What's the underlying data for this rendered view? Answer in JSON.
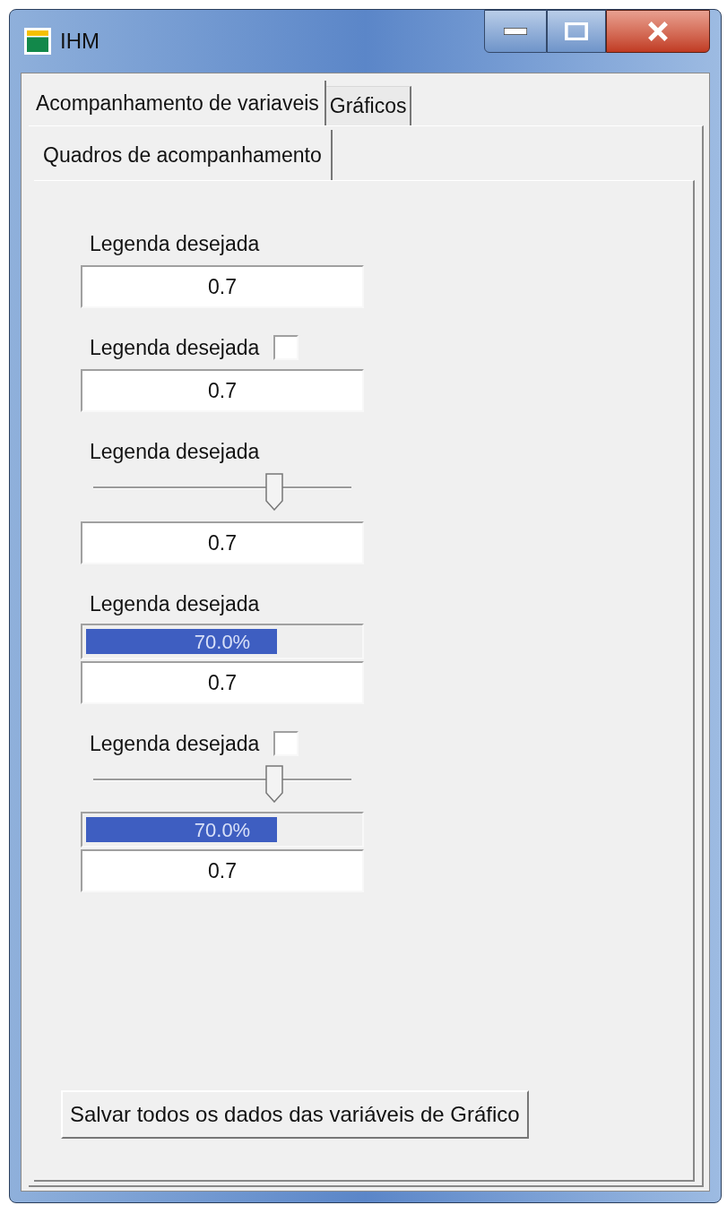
{
  "window": {
    "title": "IHM"
  },
  "tabs": [
    {
      "label": "Acompanhamento de variaveis",
      "selected": true
    },
    {
      "label": "Gráficos",
      "selected": false
    }
  ],
  "subtabs": [
    {
      "label": "Quadros de acompanhamento",
      "selected": true
    }
  ],
  "panels": [
    {
      "label": "Legenda desejada",
      "value": "0.7"
    },
    {
      "label": "Legenda desejada",
      "checkbox": {
        "checked": false
      },
      "value": "0.7"
    },
    {
      "label": "Legenda desejada",
      "slider": {
        "level": 0.7
      },
      "value": "0.7"
    },
    {
      "label": "Legenda desejada",
      "progress": {
        "level": 0.7,
        "reading": "70.0%"
      },
      "value": "0.7"
    },
    {
      "label": "Legenda desejada",
      "checkbox": {
        "checked": false
      },
      "slider": {
        "level": 0.7
      },
      "progress": {
        "level": 0.7,
        "reading": "70.0%"
      },
      "value": "0.7"
    }
  ],
  "save_button": "Salvar todos os dados das variáveis de Gráfico"
}
